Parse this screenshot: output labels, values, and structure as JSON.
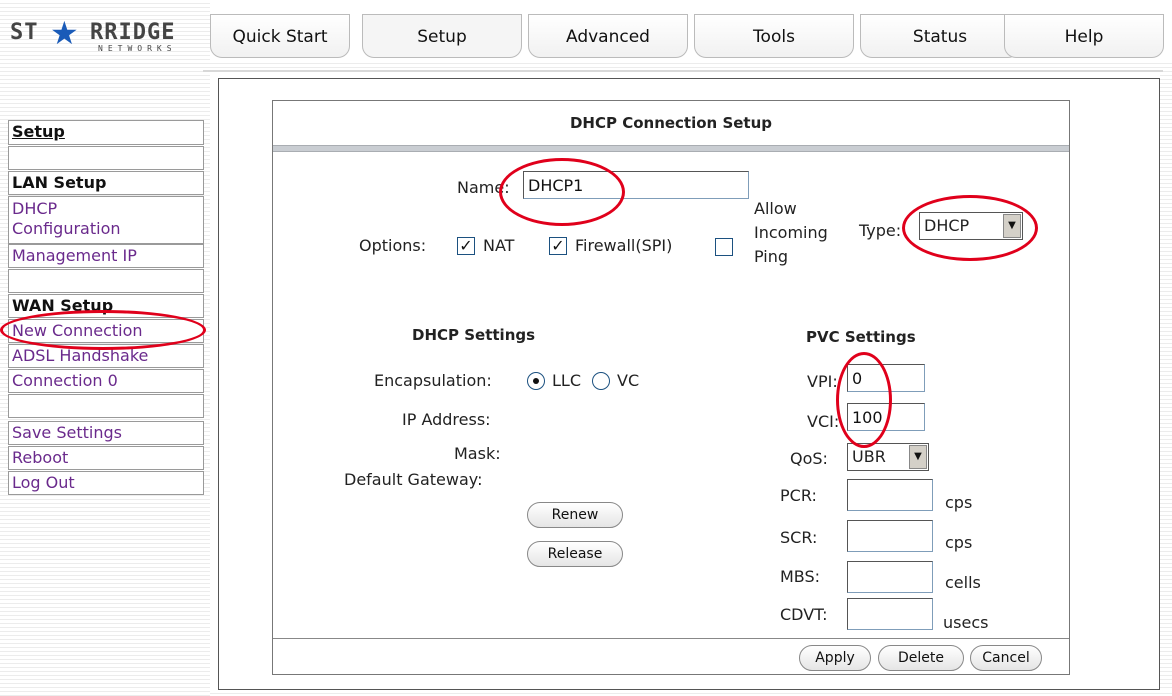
{
  "logo": {
    "left": "ST",
    "right": "RRIDGE",
    "sub": "NETWORKS"
  },
  "tabs": [
    "Quick Start",
    "Setup",
    "Advanced",
    "Tools",
    "Status",
    "Help"
  ],
  "sidebar": {
    "setup": "Setup",
    "lan_setup": "LAN Setup",
    "dhcp_config_1": "DHCP",
    "dhcp_config_2": "Configuration",
    "management_ip": "Management IP",
    "wan_setup": "WAN Setup",
    "new_connection": "New Connection",
    "adsl_handshake": "ADSL Handshake",
    "connection0": "Connection 0",
    "save_settings": "Save Settings",
    "reboot": "Reboot",
    "logout": "Log Out"
  },
  "panel": {
    "title": "DHCP Connection Setup",
    "name_label": "Name:",
    "name_value": "DHCP1",
    "options_label": "Options:",
    "nat_label": "NAT",
    "firewall_label": "Firewall(SPI)",
    "allow_ping_1": "Allow",
    "allow_ping_2": "Incoming",
    "allow_ping_3": "Ping",
    "type_label": "Type:",
    "type_value": "DHCP",
    "dhcp_settings_title": "DHCP Settings",
    "encapsulation_label": "Encapsulation:",
    "llc_label": "LLC",
    "vc_label": "VC",
    "ip_address_label": "IP Address:",
    "mask_label": "Mask:",
    "gateway_label": "Default Gateway:",
    "renew": "Renew",
    "release": "Release",
    "pvc_settings_title": "PVC Settings",
    "vpi_label": "VPI:",
    "vpi_value": "0",
    "vci_label": "VCI:",
    "vci_value": "100",
    "qos_label": "QoS:",
    "qos_value": "UBR",
    "pcr_label": "PCR:",
    "pcr_unit": "cps",
    "scr_label": "SCR:",
    "scr_unit": "cps",
    "mbs_label": "MBS:",
    "mbs_unit": "cells",
    "cdvt_label": "CDVT:",
    "cdvt_unit": "usecs",
    "apply": "Apply",
    "delete": "Delete",
    "cancel": "Cancel"
  },
  "colors": {
    "annotation": "#e0001b",
    "link": "#6a2a8c",
    "logo_star": "#1a5bb8"
  }
}
